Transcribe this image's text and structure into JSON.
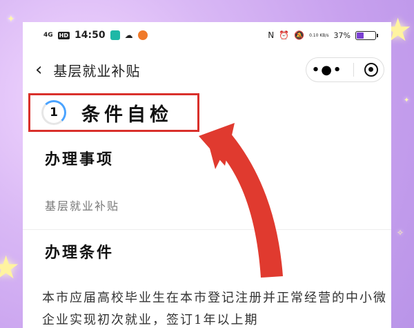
{
  "status_bar": {
    "network": "4G",
    "hd_badge": "HD",
    "time": "14:50",
    "speed": "0.10 KB/s",
    "battery_level": "37%"
  },
  "nav": {
    "back_icon": "chevron-left-icon",
    "title": "基层就业补贴",
    "more_icon": "more-dots-icon",
    "close_icon": "target-icon"
  },
  "step": {
    "number": "1",
    "title": "条件自检",
    "highlight_color": "#d9302b"
  },
  "sections": {
    "matter_title": "办理事项",
    "matter_value": "基层就业补贴",
    "condition_title": "办理条件",
    "condition_text": "本市应届高校毕业生在本市登记注册并正常经营的中小微企业实现初次就业，签订1年以上期"
  },
  "annotation": {
    "arrow_color": "#e03a2f"
  }
}
